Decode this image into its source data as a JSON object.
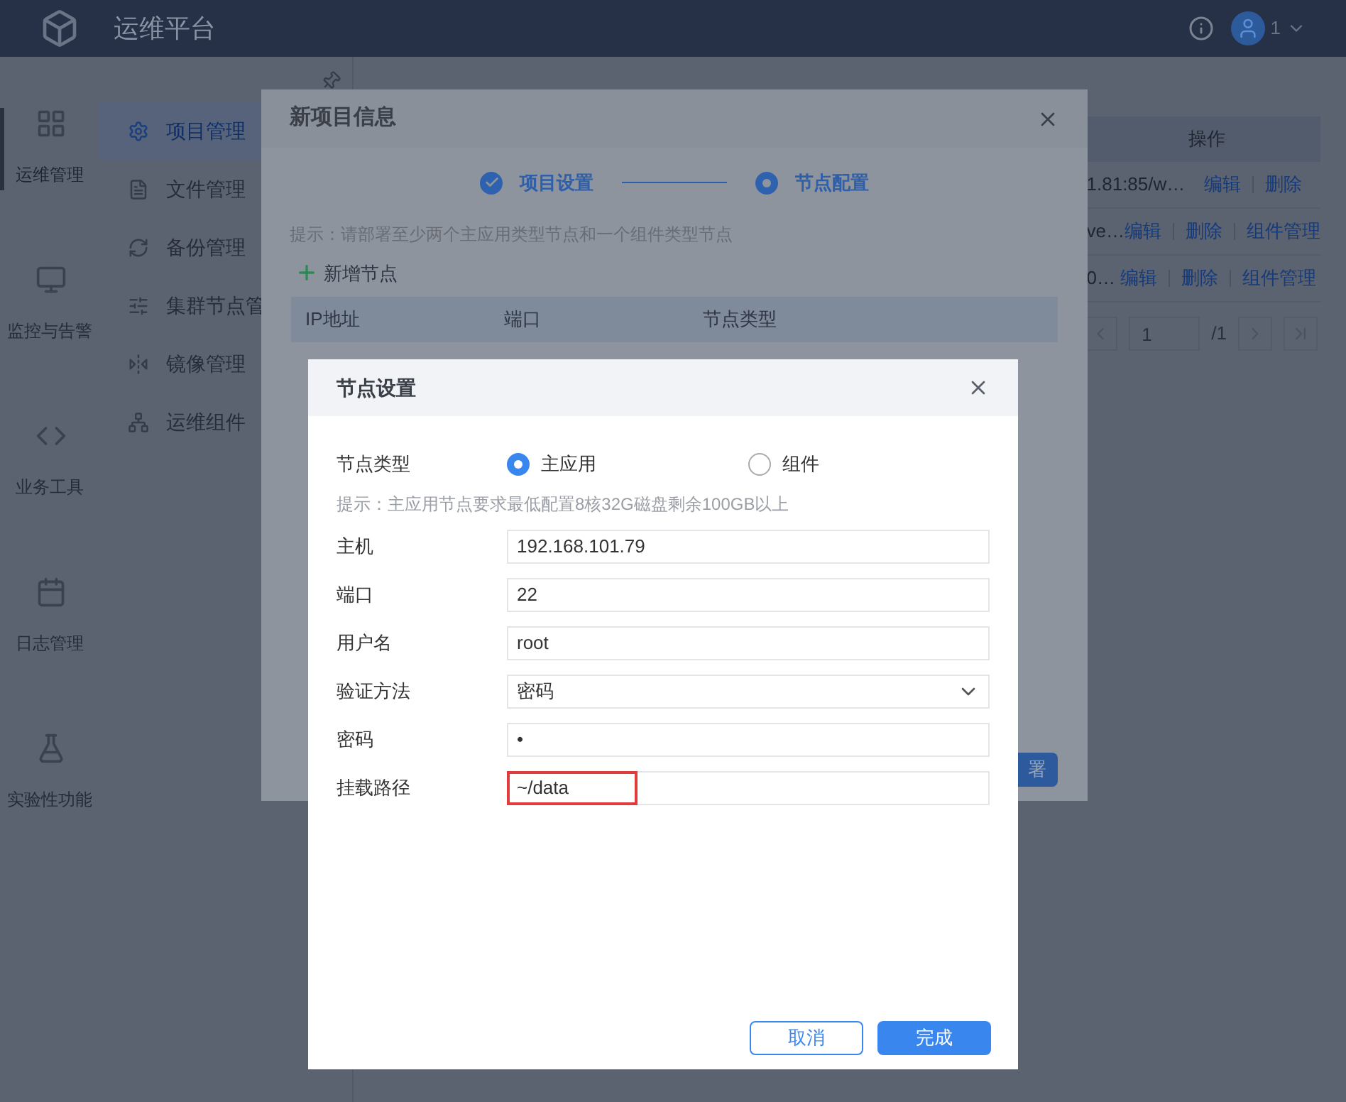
{
  "header": {
    "title": "运维平台",
    "user": "1"
  },
  "rail": [
    {
      "label": "运维管理",
      "selected": true
    },
    {
      "label": "监控与告警",
      "selected": false
    },
    {
      "label": "业务工具",
      "selected": false
    },
    {
      "label": "日志管理",
      "selected": false
    },
    {
      "label": "实验性功能",
      "selected": false
    }
  ],
  "sidebar": [
    {
      "label": "项目管理",
      "selected": true
    },
    {
      "label": "文件管理",
      "selected": false
    },
    {
      "label": "备份管理",
      "selected": false
    },
    {
      "label": "集群节点管",
      "selected": false
    },
    {
      "label": "镜像管理",
      "selected": false
    },
    {
      "label": "运维组件",
      "selected": false
    }
  ],
  "table": {
    "columns": [
      "操作"
    ],
    "rows": [
      {
        "column_1": "1.81:85/w…",
        "actions": [
          "编辑",
          "删除"
        ]
      },
      {
        "column_1": "ve…",
        "actions": [
          "编辑",
          "删除",
          "组件管理"
        ]
      },
      {
        "column_1": "0…",
        "actions": [
          "编辑",
          "删除",
          "组件管理"
        ]
      }
    ],
    "pagination": {
      "page": "1",
      "total": "/1"
    }
  },
  "project_dialog": {
    "title": "新项目信息",
    "steps": [
      {
        "label": "项目设置",
        "completed": true
      },
      {
        "label": "节点配置",
        "completed": false
      }
    ],
    "hint": "提示：请部署至少两个主应用类型节点和一个组件类型节点",
    "add_button": "新增节点",
    "columns": [
      "IP地址",
      "端口",
      "节点类型"
    ],
    "deploy_button": "署"
  },
  "node_dialog": {
    "title": "节点设置",
    "type_label": "节点类型",
    "types": [
      {
        "label": "主应用",
        "selected": true
      },
      {
        "label": "组件",
        "selected": false
      }
    ],
    "hint": "提示：主应用节点要求最低配置8核32G磁盘剩余100GB以上",
    "fields": [
      {
        "label": "主机",
        "kind": "text",
        "value": "192.168.101.79",
        "highlighted": false
      },
      {
        "label": "端口",
        "kind": "text",
        "value": "22",
        "highlighted": false
      },
      {
        "label": "用户名",
        "kind": "text",
        "value": "root",
        "highlighted": false
      },
      {
        "label": "验证方法",
        "kind": "select",
        "value": "密码",
        "highlighted": false
      },
      {
        "label": "密码",
        "kind": "text",
        "value": "•",
        "highlighted": false
      },
      {
        "label": "挂载路径",
        "kind": "text",
        "value": "~/data",
        "highlighted": true
      }
    ],
    "buttons": [
      "取消",
      "完成"
    ]
  }
}
